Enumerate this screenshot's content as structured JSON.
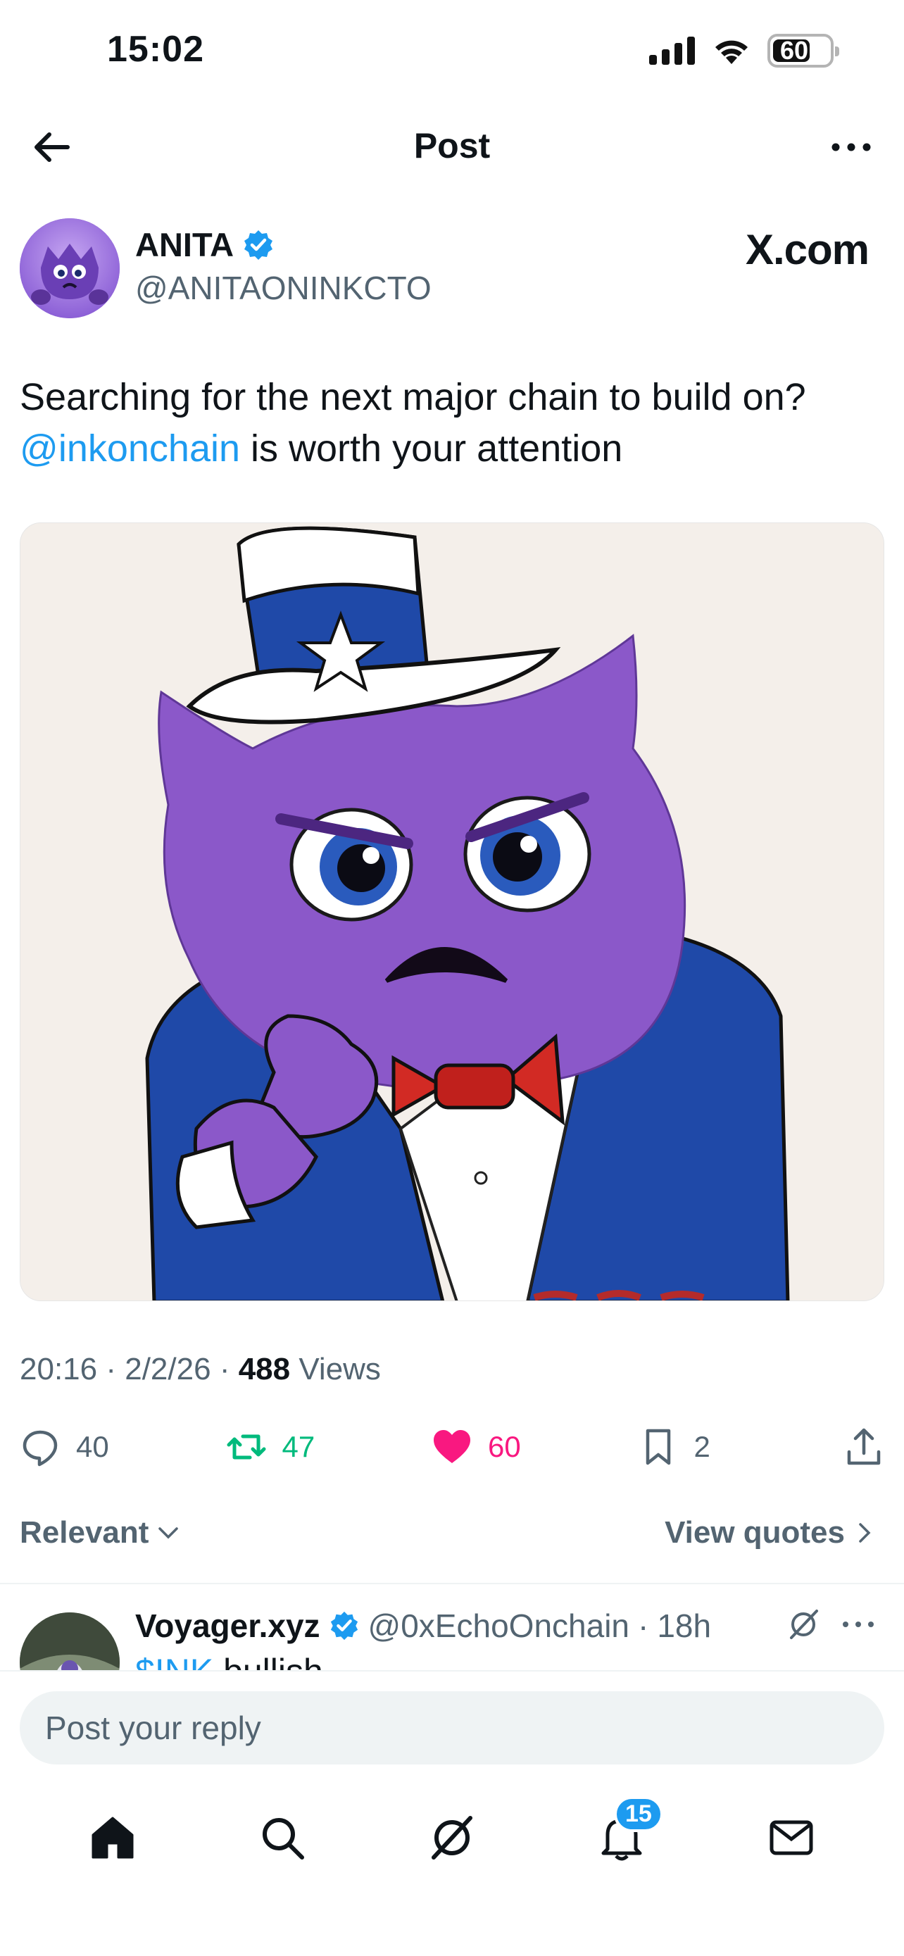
{
  "status_bar": {
    "time": "15:02",
    "battery": "60"
  },
  "header": {
    "title": "Post"
  },
  "author": {
    "name": "ANITA",
    "handle": "@ANITAONINKCTO",
    "site_mark": "X.com"
  },
  "post": {
    "text_line1": "Searching for the next major chain to build on?",
    "mention": "@inkonchain",
    "text_line2_rest": " is worth your attention"
  },
  "meta": {
    "time": "20:16",
    "date": "2/2/26",
    "views_count": "488",
    "views_label": "Views",
    "sep": "·"
  },
  "actions": {
    "replies": "40",
    "reposts": "47",
    "likes": "60",
    "bookmarks": "2"
  },
  "sort": {
    "label": "Relevant",
    "quotes_label": "View quotes"
  },
  "reply": {
    "name": "Voyager.xyz",
    "handle": "@0xEchoOnchain",
    "age": "18h",
    "cashtag": "$INK",
    "text_rest": " bullish"
  },
  "composer": {
    "placeholder": "Post your reply"
  },
  "nav": {
    "notifications_badge": "15"
  },
  "colors": {
    "accent": "#1d9bf0",
    "repost": "#00ba7c",
    "like": "#f91880",
    "muted": "#536471"
  }
}
